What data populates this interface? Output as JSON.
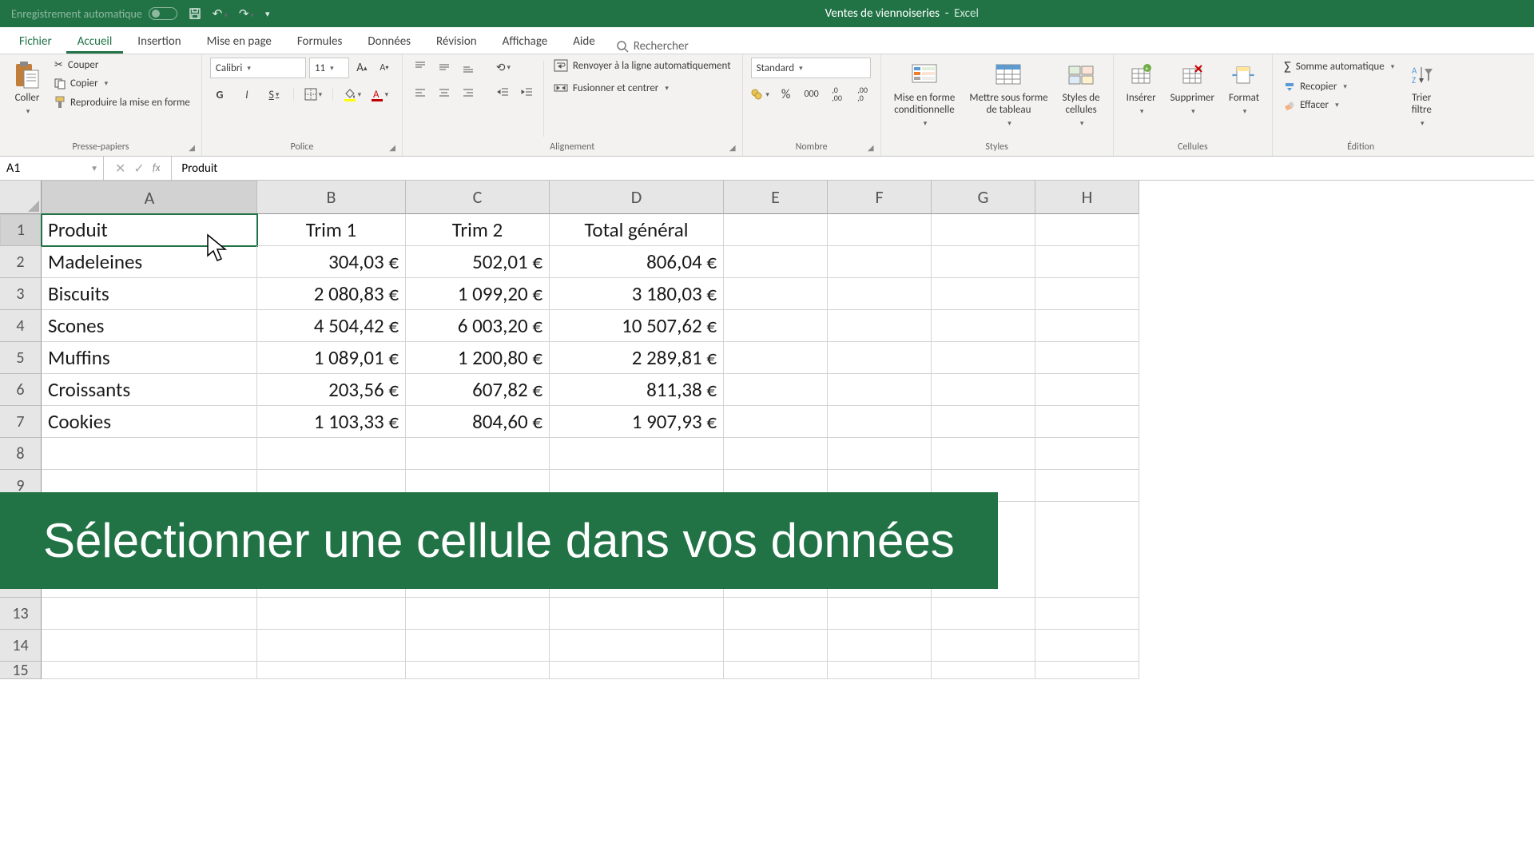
{
  "titlebar": {
    "autosave": "Enregistrement automatique",
    "docname": "Ventes de viennoiseries",
    "appname": "Excel"
  },
  "tabs": {
    "file": "Fichier",
    "items": [
      "Accueil",
      "Insertion",
      "Mise en page",
      "Formules",
      "Données",
      "Révision",
      "Affichage",
      "Aide"
    ],
    "active": 0,
    "search": "Rechercher"
  },
  "ribbon": {
    "clipboard": {
      "label": "Presse-papiers",
      "paste": "Coller",
      "cut": "Couper",
      "copy": "Copier",
      "painter": "Reproduire la mise en forme"
    },
    "font": {
      "label": "Police",
      "name": "Calibri",
      "size": "11"
    },
    "align": {
      "label": "Alignement",
      "wrap": "Renvoyer à la ligne automatiquement",
      "merge": "Fusionner et centrer"
    },
    "number": {
      "label": "Nombre",
      "format": "Standard"
    },
    "styles": {
      "label": "Styles",
      "cond": "Mise en forme\nconditionnelle",
      "table": "Mettre sous forme\nde tableau",
      "cell": "Styles de\ncellules"
    },
    "cells": {
      "label": "Cellules",
      "insert": "Insérer",
      "delete": "Supprimer",
      "format": "Format"
    },
    "editing": {
      "label": "Édition",
      "sum": "Somme automatique",
      "fill": "Recopier",
      "clear": "Effacer",
      "sort": "Trier\nfiltre"
    }
  },
  "formula": {
    "cellref": "A1",
    "content": "Produit"
  },
  "columns": [
    "A",
    "B",
    "C",
    "D",
    "E",
    "F",
    "G",
    "H"
  ],
  "rows": [
    "1",
    "2",
    "3",
    "4",
    "5",
    "6",
    "7",
    "8",
    "9",
    "",
    "13",
    "14",
    "15"
  ],
  "sheet": {
    "headers": [
      "Produit",
      "Trim 1",
      "Trim 2",
      "Total général"
    ],
    "data": [
      {
        "p": "Madeleines",
        "t1": "304,03 €",
        "t2": "502,01 €",
        "tot": "806,04 €"
      },
      {
        "p": "Biscuits",
        "t1": "2 080,83 €",
        "t2": "1 099,20 €",
        "tot": "3 180,03 €"
      },
      {
        "p": "Scones",
        "t1": "4 504,42 €",
        "t2": "6 003,20 €",
        "tot": "10 507,62 €"
      },
      {
        "p": "Muffins",
        "t1": "1 089,01 €",
        "t2": "1 200,80 €",
        "tot": "2 289,81 €"
      },
      {
        "p": "Croissants",
        "t1": "203,56 €",
        "t2": "607,82 €",
        "tot": "811,38 €"
      },
      {
        "p": "Cookies",
        "t1": "1 103,33 €",
        "t2": "804,60 €",
        "tot": "1 907,93 €"
      }
    ]
  },
  "chart_data": {
    "type": "table",
    "title": "Ventes de viennoiseries",
    "columns": [
      "Produit",
      "Trim 1",
      "Trim 2",
      "Total général"
    ],
    "rows": [
      [
        "Madeleines",
        304.03,
        502.01,
        806.04
      ],
      [
        "Biscuits",
        2080.83,
        1099.2,
        3180.03
      ],
      [
        "Scones",
        4504.42,
        6003.2,
        10507.62
      ],
      [
        "Muffins",
        1089.01,
        1200.8,
        2289.81
      ],
      [
        "Croissants",
        203.56,
        607.82,
        811.38
      ],
      [
        "Cookies",
        1103.33,
        804.6,
        1907.93
      ]
    ],
    "currency": "EUR"
  },
  "banner": "Sélectionner une cellule dans vos données"
}
